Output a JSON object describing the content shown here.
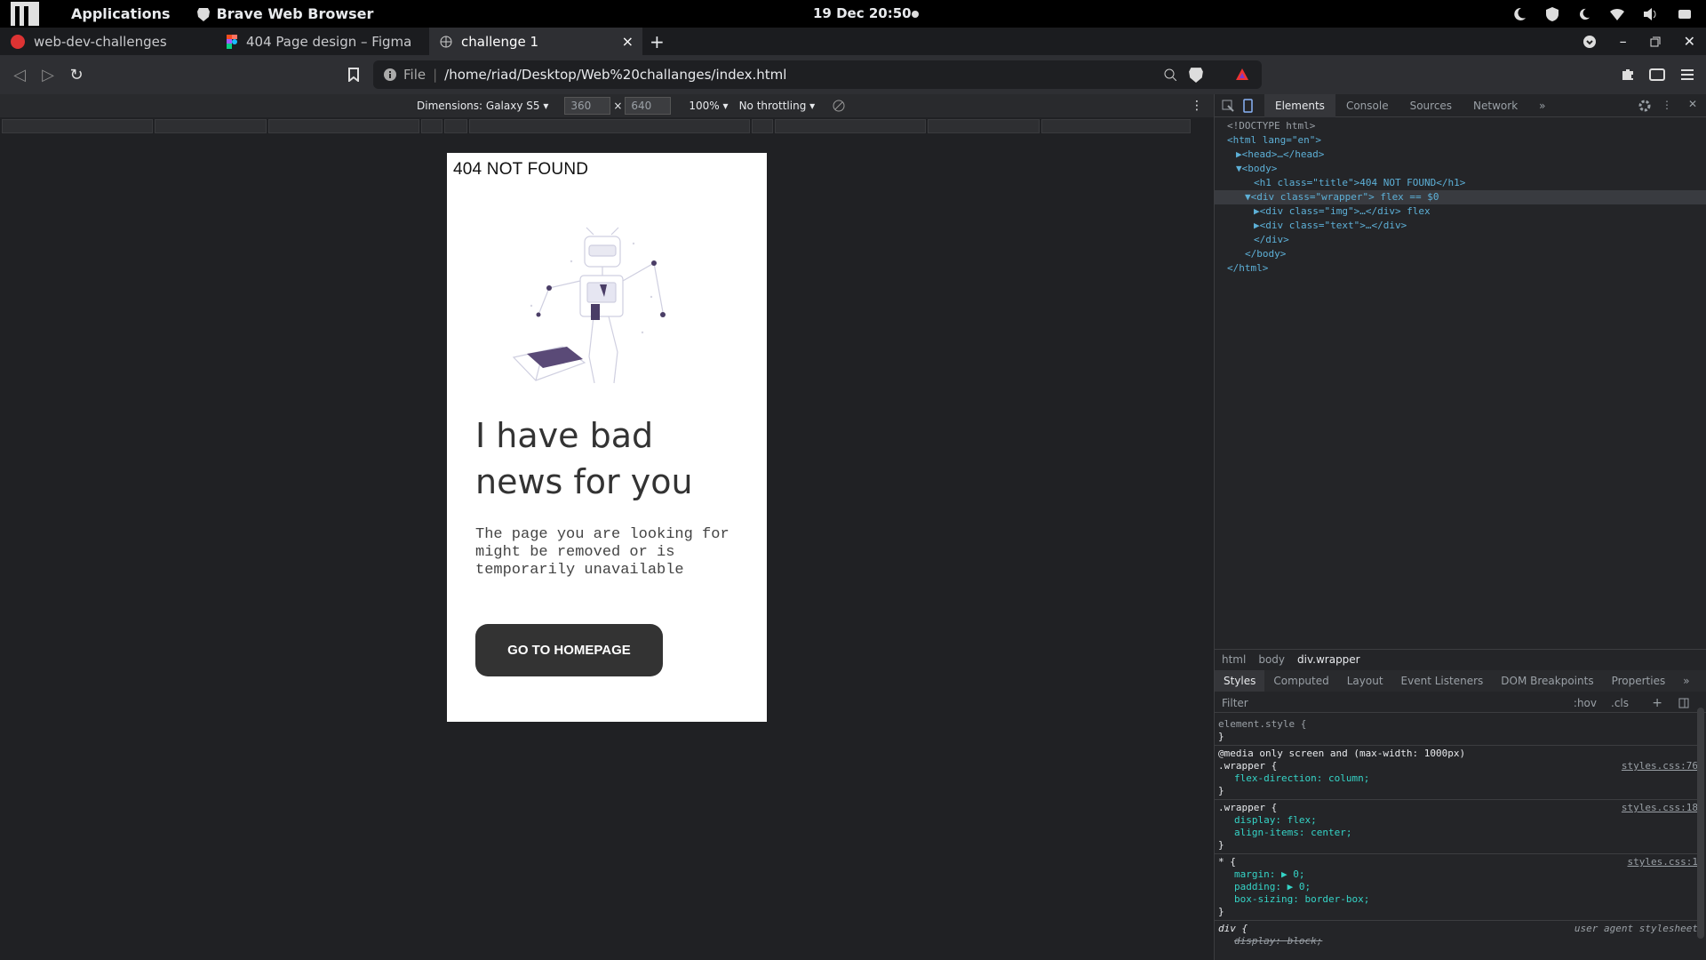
{
  "system_bar": {
    "applications": "Applications",
    "active_app": "Brave Web Browser",
    "datetime": "19 Dec  20:50"
  },
  "tabs": [
    {
      "label": "web-dev-challenges"
    },
    {
      "label": "404 Page design – Figma"
    },
    {
      "label": "challenge 1",
      "close": "×"
    }
  ],
  "new_tab": "+",
  "address": {
    "scheme": "File",
    "url": "/home/riad/Desktop/Web%20challanges/index.html"
  },
  "device_toolbar": {
    "dimensions": "Dimensions: Galaxy S5 ▾",
    "width": "360",
    "times": "×",
    "height": "640",
    "zoom": "100% ▾",
    "throttling": "No throttling ▾"
  },
  "page": {
    "title": "404 NOT FOUND",
    "headline": "I have bad news for you",
    "paragraph": "The page you are looking for might be removed or is temporarily unavailable",
    "button": "GO TO HOMEPAGE"
  },
  "devtools": {
    "tabs": [
      "Elements",
      "Console",
      "Sources",
      "Network",
      "»"
    ],
    "dom": {
      "doctype": "<!DOCTYPE html>",
      "html_open": "<html lang=\"en\">",
      "head": "▶<head>…</head>",
      "body_open": "▼<body>",
      "h1": "<h1 class=\"title\">404 NOT FOUND</h1>",
      "wrapper": "▼<div class=\"wrapper\"> flex == $0",
      "img": "▶<div class=\"img\">…</div> flex",
      "text": "▶<div class=\"text\">…</div>",
      "div_close": "</div>",
      "body_close": "</body>",
      "html_close": "</html>"
    },
    "breadcrumb": [
      "html",
      "body",
      "div.wrapper"
    ],
    "style_tabs": [
      "Styles",
      "Computed",
      "Layout",
      "Event Listeners",
      "DOM Breakpoints",
      "Properties",
      "»"
    ],
    "filter_placeholder": "Filter",
    "hov": ":hov",
    "cls": ".cls",
    "rules": {
      "element_style": "element.style {",
      "close_brace": "}",
      "media": "@media only screen and (max-width: 1000px)",
      "wrapper_sel": ".wrapper {",
      "wrapper_src1": "styles.css:76",
      "fd": "flex-direction: column;",
      "wrapper_src2": "styles.css:18",
      "display": "display: flex;",
      "align": "align-items: center;",
      "star": "* {",
      "star_src": "styles.css:1",
      "margin": "margin: ▶ 0;",
      "padding": "padding: ▶ 0;",
      "boxsizing": "box-sizing: border-box;",
      "div_sel": "div {",
      "ua": "user agent stylesheet",
      "display_block": "display: block;"
    }
  }
}
